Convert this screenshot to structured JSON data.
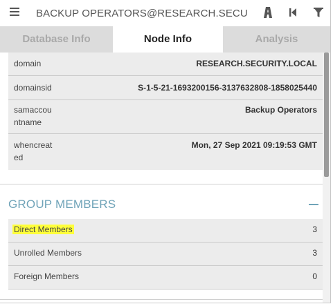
{
  "header": {
    "title": "BACKUP OPERATORS@RESEARCH.SECURITY.LOCAL",
    "icons": [
      "menu-icon",
      "pathfinding-icon",
      "back-icon",
      "filter-icon"
    ]
  },
  "tabs": [
    {
      "label": "Database Info",
      "active": false
    },
    {
      "label": "Node Info",
      "active": true
    },
    {
      "label": "Analysis",
      "active": false
    }
  ],
  "properties": [
    {
      "key": "domain",
      "value": "RESEARCH.SECURITY.LOCAL"
    },
    {
      "key": "domainsid",
      "value": "S-1-5-21-1693200156-3137632808-1858025440"
    },
    {
      "key": "samaccou\nntname",
      "value": "Backup Operators"
    },
    {
      "key": "whencreat\ned",
      "value": "Mon, 27 Sep 2021 09:19:53 GMT"
    }
  ],
  "group_members": {
    "title": "GROUP MEMBERS",
    "rows": [
      {
        "label": "Direct Members",
        "value": "3",
        "highlighted": true
      },
      {
        "label": "Unrolled Members",
        "value": "3",
        "highlighted": false
      },
      {
        "label": "Foreign Members",
        "value": "0",
        "highlighted": false
      }
    ]
  },
  "colors": {
    "section_accent": "#6fa3b8",
    "highlight": "#ffff3a",
    "tab_bar": "#dcdcdc",
    "row_bg": "#ececec"
  }
}
